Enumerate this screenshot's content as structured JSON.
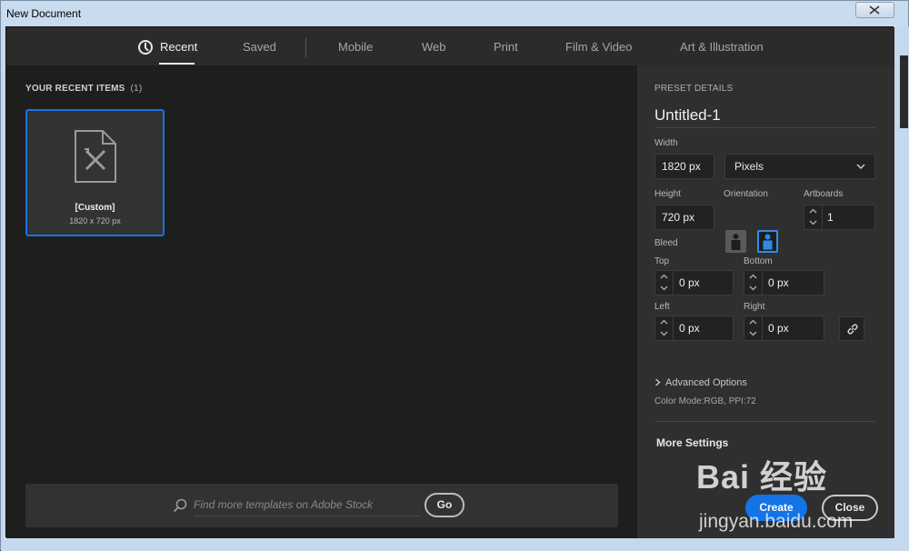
{
  "window": {
    "title": "New Document"
  },
  "tabs": [
    {
      "label": "Recent"
    },
    {
      "label": "Saved"
    },
    {
      "label": "Mobile"
    },
    {
      "label": "Web"
    },
    {
      "label": "Print"
    },
    {
      "label": "Film & Video"
    },
    {
      "label": "Art & Illustration"
    }
  ],
  "recent": {
    "heading": "YOUR RECENT ITEMS",
    "count": "(1)",
    "items": [
      {
        "title": "[Custom]",
        "size": "1820 x 720 px"
      }
    ]
  },
  "stock": {
    "placeholder": "Find more templates on Adobe Stock",
    "go_label": "Go"
  },
  "preset": {
    "heading": "PRESET DETAILS",
    "name": "Untitled-1",
    "width_label": "Width",
    "width_value": "1820 px",
    "units_value": "Pixels",
    "height_label": "Height",
    "height_value": "720 px",
    "orientation_label": "Orientation",
    "artboards_label": "Artboards",
    "artboards_value": "1",
    "bleed_label": "Bleed",
    "top_label": "Top",
    "top_value": "0 px",
    "bottom_label": "Bottom",
    "bottom_value": "0 px",
    "left_label": "Left",
    "left_value": "0 px",
    "right_label": "Right",
    "right_value": "0 px",
    "advanced_label": "Advanced Options",
    "color_mode": "Color Mode:RGB, PPI:72",
    "more_settings": "More Settings",
    "create_label": "Create",
    "close_label": "Close"
  },
  "watermark": {
    "brand": "Bai 经验",
    "url": "jingyan.baidu.com"
  },
  "colors": {
    "accent": "#1473e6",
    "panel": "#2f2f2f",
    "background": "#1e1e1e"
  }
}
